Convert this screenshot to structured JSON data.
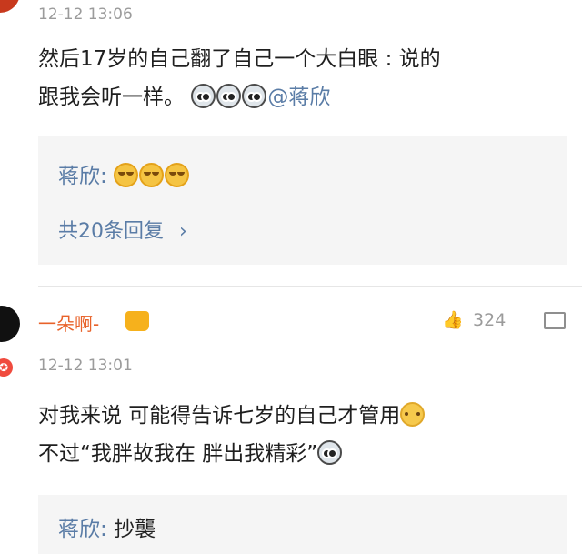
{
  "comment1": {
    "time": "12-12 13:06",
    "text_line1": "然后17岁的自己翻了自己一个大白眼 : 说的",
    "text_line2_prefix": "跟我会听一样。",
    "mention": "@蒋欣",
    "emoji_names": [
      "husky-emoji",
      "husky-emoji",
      "husky-emoji"
    ]
  },
  "reply1": {
    "name": "蒋欣",
    "separator": ":",
    "emoji_names": [
      "laugh-cry-emoji",
      "laugh-cry-emoji",
      "laugh-cry-emoji"
    ],
    "more_label": "共20条回复",
    "more_chevron": "›"
  },
  "comment2": {
    "username": "一朵啊-",
    "time": "12-12 13:01",
    "likes": "324",
    "text_line1": "对我来说 可能得告诉七岁的自己才管用",
    "text_line2": "不过“我胖故我在 胖出我精彩”",
    "badge": "✪"
  },
  "reply2": {
    "name": "蒋欣",
    "separator": ":",
    "text": "抄襲"
  }
}
